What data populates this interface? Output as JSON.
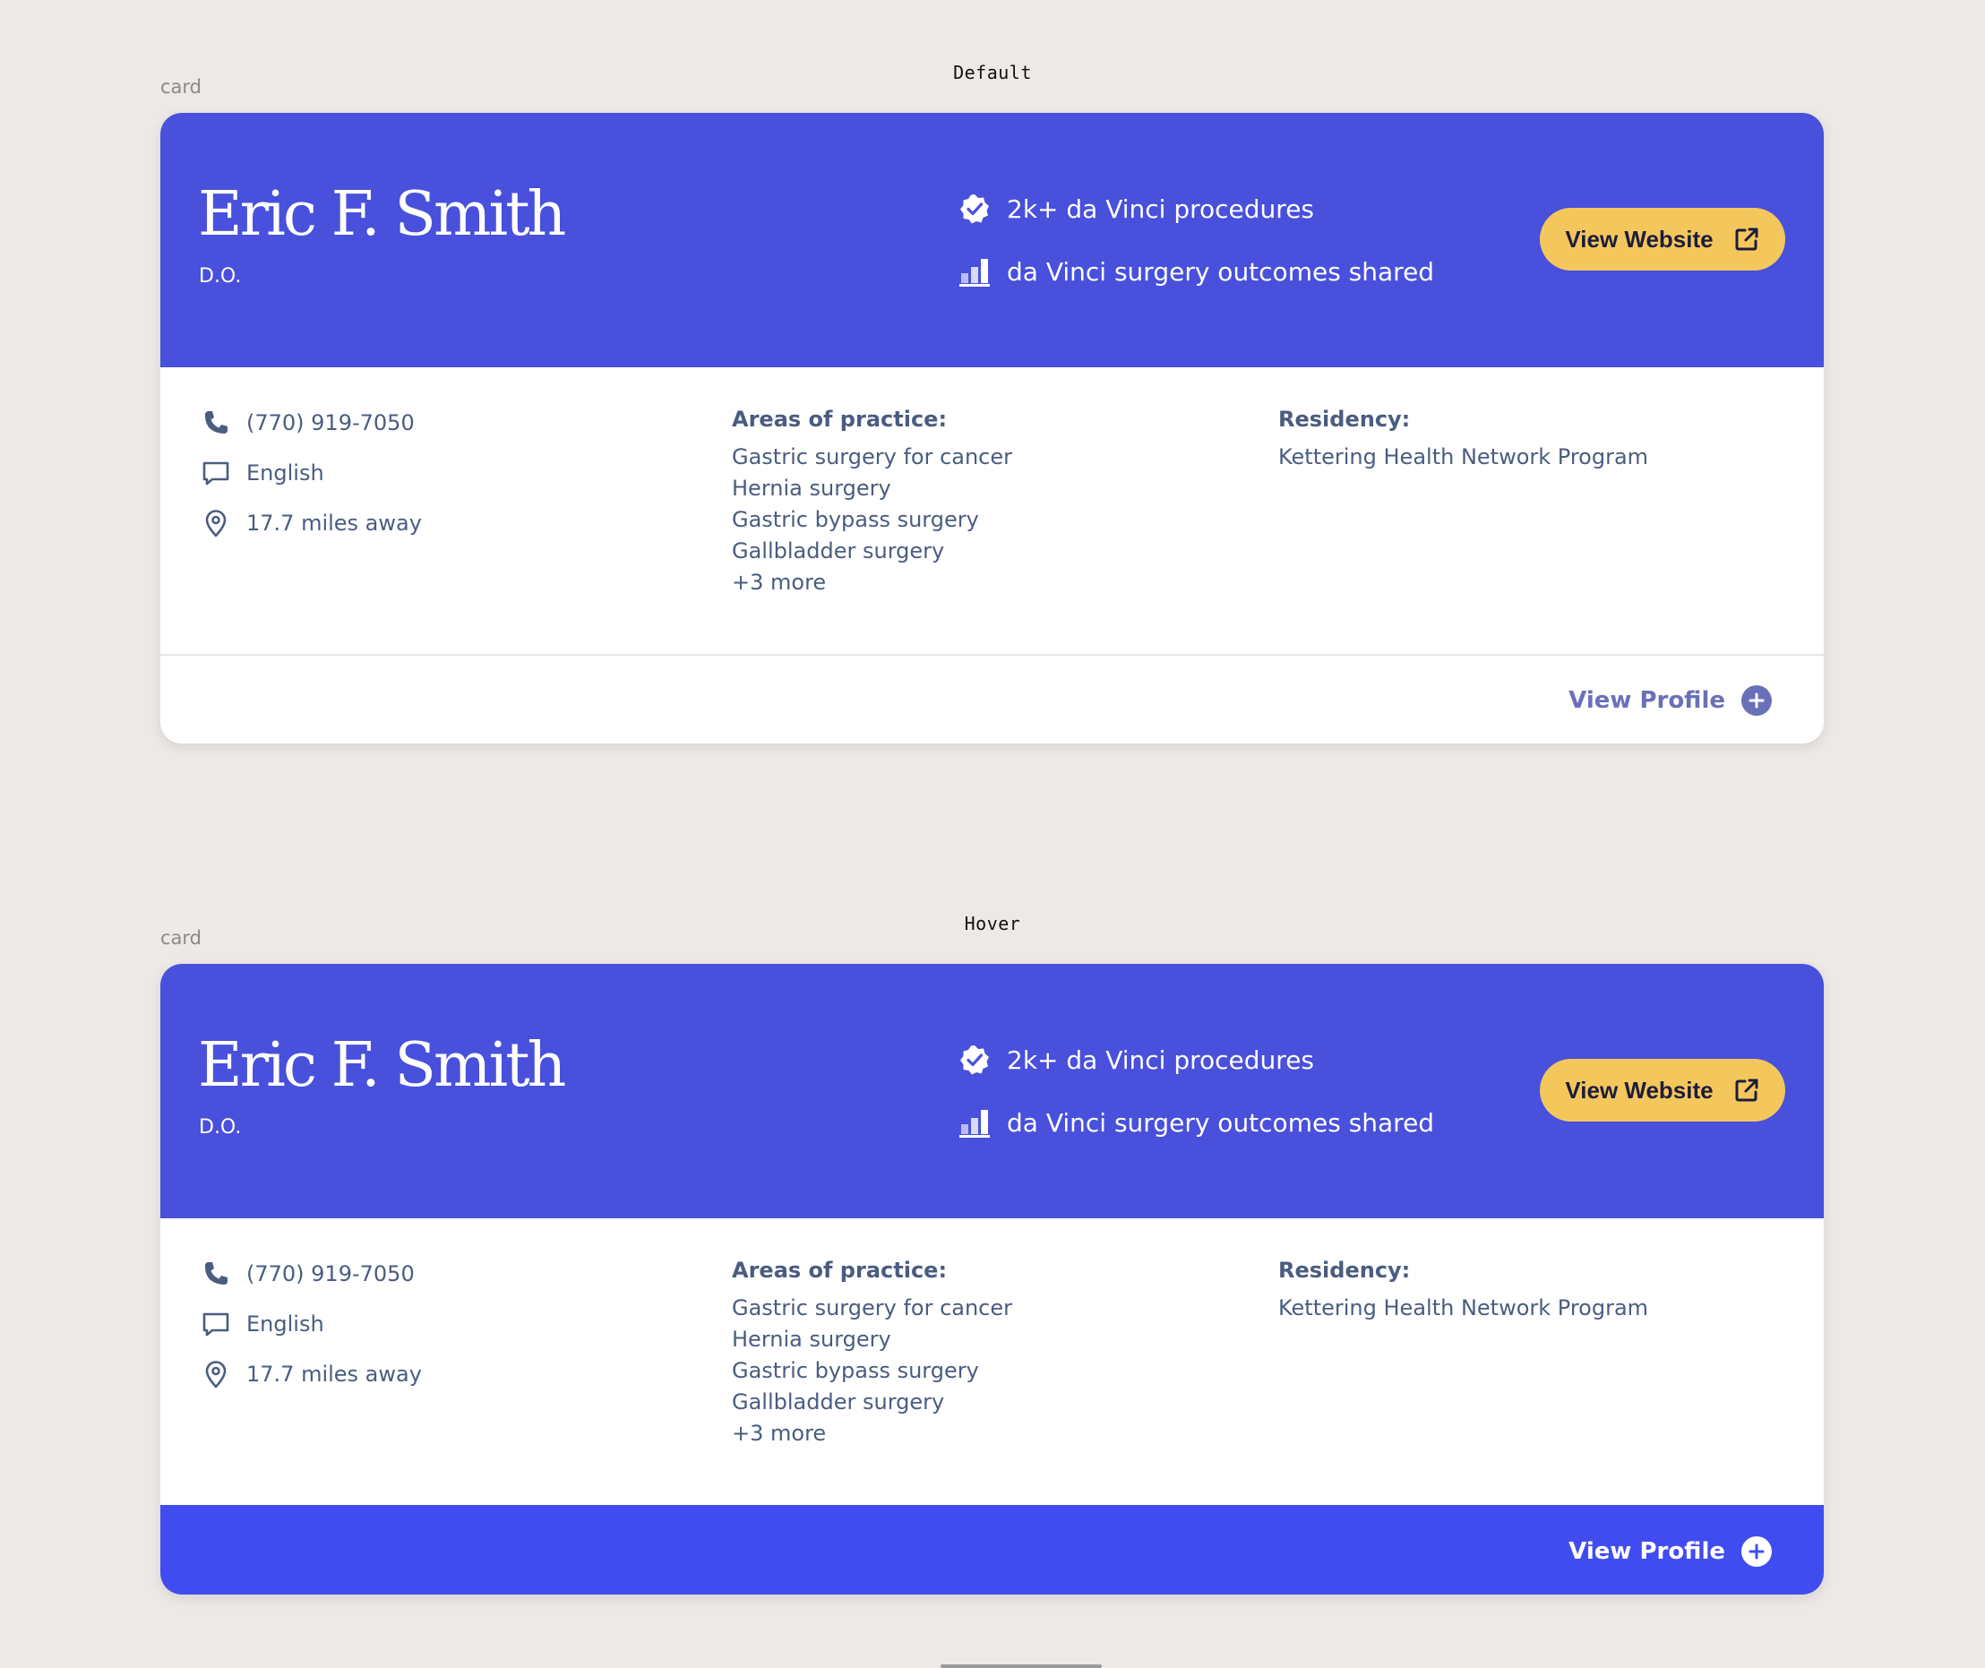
{
  "states": [
    {
      "state_label": "Default",
      "frame_label": "card",
      "header": {
        "name": "Eric F. Smith",
        "credential": "D.O.",
        "stats": [
          {
            "icon": "verified-badge-icon",
            "text": "2k+ da Vinci procedures"
          },
          {
            "icon": "bar-chart-icon",
            "text": "da Vinci surgery outcomes shared"
          }
        ],
        "website_button": {
          "label": "View Website",
          "icon": "external-link-icon"
        }
      },
      "contact": {
        "phone": "(770) 919-7050",
        "language": "English",
        "distance": "17.7 miles away"
      },
      "practice": {
        "title": "Areas of practice:",
        "items": [
          "Gastric surgery for cancer",
          "Hernia surgery",
          "Gastric bypass surgery",
          "Gallbladder surgery",
          "+3 more"
        ]
      },
      "residency": {
        "title": "Residency:",
        "value": "Kettering Health Network Program"
      },
      "footer": {
        "profile_label": "View Profile",
        "icon": "plus-circle-icon"
      }
    },
    {
      "state_label": "Hover",
      "frame_label": "card",
      "header": {
        "name": "Eric F. Smith",
        "credential": "D.O.",
        "stats": [
          {
            "icon": "verified-badge-icon",
            "text": "2k+ da Vinci procedures"
          },
          {
            "icon": "bar-chart-icon",
            "text": "da Vinci surgery outcomes shared"
          }
        ],
        "website_button": {
          "label": "View Website",
          "icon": "external-link-icon"
        }
      },
      "contact": {
        "phone": "(770) 919-7050",
        "language": "English",
        "distance": "17.7 miles away"
      },
      "practice": {
        "title": "Areas of practice:",
        "items": [
          "Gastric surgery for cancer",
          "Hernia surgery",
          "Gastric bypass surgery",
          "Gallbladder surgery",
          "+3 more"
        ]
      },
      "residency": {
        "title": "Residency:",
        "value": "Kettering Health Network Program"
      },
      "footer": {
        "profile_label": "View Profile",
        "icon": "plus-circle-icon"
      }
    }
  ],
  "colors": {
    "page_bg": "#ede9e6",
    "header_bg": "#4850dc",
    "website_button_bg": "#f4c75d",
    "body_text": "#4a5c80",
    "hover_footer_bg": "#414cf0",
    "profile_link": "#6a70b8"
  }
}
